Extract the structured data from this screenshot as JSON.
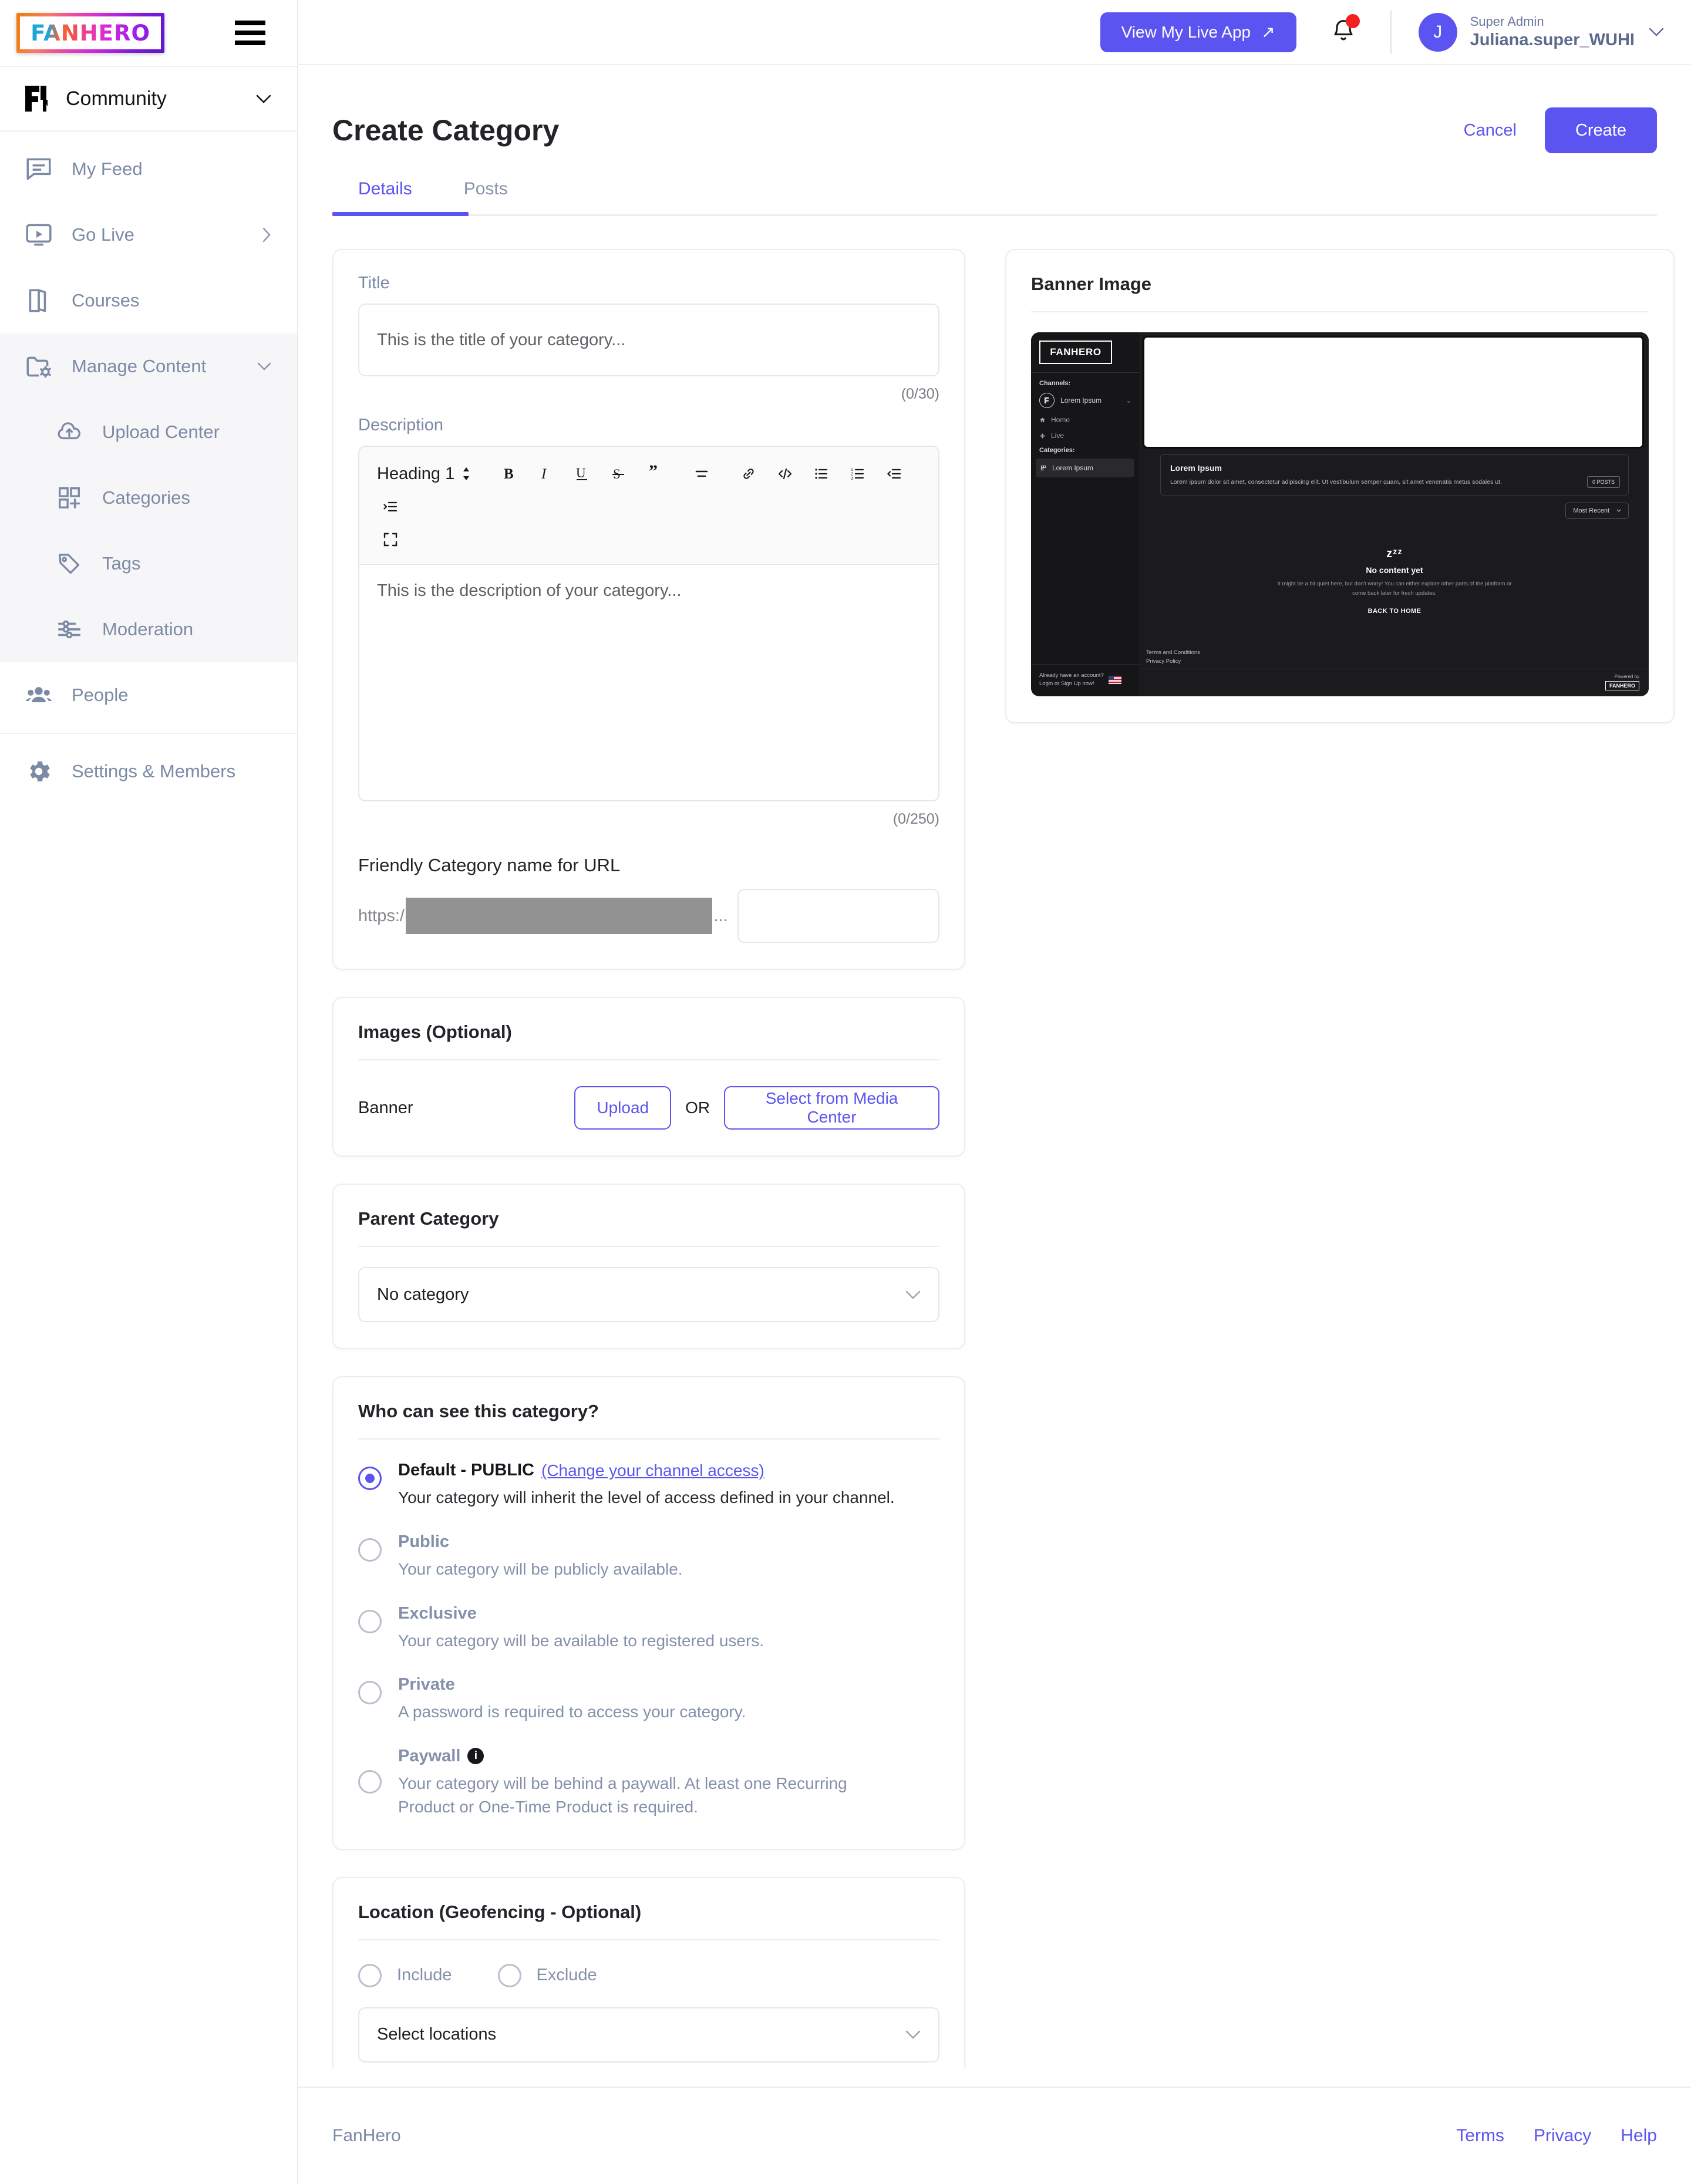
{
  "brand": {
    "logo_text": "FANHERO",
    "footer_name": "FanHero"
  },
  "sidebar": {
    "community": {
      "label": "Community"
    },
    "items": [
      {
        "label": "My Feed",
        "icon": "feed-icon"
      },
      {
        "label": "Go Live",
        "icon": "live-icon"
      },
      {
        "label": "Courses",
        "icon": "courses-icon"
      }
    ],
    "manage": {
      "label": "Manage Content",
      "icon": "folder-gear-icon"
    },
    "manage_children": [
      {
        "label": "Upload Center",
        "icon": "cloud-upload-icon"
      },
      {
        "label": "Categories",
        "icon": "grid-plus-icon"
      },
      {
        "label": "Tags",
        "icon": "tag-icon"
      },
      {
        "label": "Moderation",
        "icon": "sliders-icon"
      }
    ],
    "people": {
      "label": "People",
      "icon": "people-icon"
    },
    "settings": {
      "label": "Settings & Members",
      "icon": "gear-icon"
    }
  },
  "topbar": {
    "live_app_label": "View My Live App",
    "live_app_arrow": "↗",
    "user_role": "Super Admin",
    "user_name": "Juliana.super_WUHI",
    "avatar_initial": "J"
  },
  "page": {
    "title": "Create Category",
    "cancel_label": "Cancel",
    "create_label": "Create",
    "tabs": [
      {
        "label": "Details",
        "active": true
      },
      {
        "label": "Posts",
        "active": false
      }
    ]
  },
  "details": {
    "title_label": "Title",
    "title_placeholder": "This is the title of your category...",
    "title_counter": "(0/30)",
    "description_label": "Description",
    "description_placeholder": "This is the description of your category...",
    "description_counter": "(0/250)",
    "editor_heading": "Heading 1",
    "editor_tools": [
      "bold-icon",
      "italic-icon",
      "underline-icon",
      "strikethrough-icon",
      "quote-icon",
      "align-icon",
      "link-icon",
      "code-icon",
      "bullet-list-icon",
      "numbered-list-icon",
      "outdent-icon",
      "indent-icon",
      "fullscreen-icon"
    ],
    "url_label": "Friendly Category name for URL",
    "url_protocol": "https:/",
    "url_ellipsis": "...",
    "url_slug_value": ""
  },
  "images": {
    "title": "Images (Optional)",
    "banner_label": "Banner",
    "upload_label": "Upload",
    "or_label": "OR",
    "media_center_label": "Select from Media Center"
  },
  "parent_category": {
    "title": "Parent Category",
    "selected": "No category"
  },
  "visibility": {
    "title": "Who can see this category?",
    "options": [
      {
        "label": "Default - PUBLIC",
        "link": "(Change your channel access)",
        "desc": "Your category will inherit the level of access defined in your channel.",
        "selected": true
      },
      {
        "label": "Public",
        "desc": "Your category will be publicly available.",
        "selected": false
      },
      {
        "label": "Exclusive",
        "desc": "Your category will be available to registered users.",
        "selected": false
      },
      {
        "label": "Private",
        "desc": "A password is required to access your category.",
        "selected": false
      },
      {
        "label": "Paywall",
        "info": "i",
        "desc": "Your category will be behind a paywall. At least one Recurring Product or One-Time Product is required.",
        "selected": false
      }
    ]
  },
  "location": {
    "title": "Location (Geofencing - Optional)",
    "include_label": "Include",
    "exclude_label": "Exclude",
    "select_placeholder": "Select locations"
  },
  "banner_preview": {
    "title": "Banner Image",
    "logo": "FANHERO",
    "channels_caption": "Channels:",
    "channel_name": "Lorem Ipsum",
    "channel_chevron": "⌄",
    "nav": [
      {
        "label": "Home"
      },
      {
        "label": "Live"
      }
    ],
    "categories_caption": "Categories:",
    "category_item": "Lorem Ipsum",
    "card_title": "Lorem Ipsum",
    "card_body": "Lorem ipsum dolor sit amet, consectetur adipiscing elit. Ut vestibulum semper quam, sit amet venenatis metus sodales ut.",
    "posts_badge": "0 POSTS",
    "sort_label": "Most Recent",
    "empty_zzz": "zᶻᶻ",
    "empty_title": "No content yet",
    "empty_body": "It might be a bit quiet here, but don't worry! You can either explore other parts of the platform or come back later for fresh updates.",
    "back_home": "BACK TO HOME",
    "login_line1": "Already have an account?",
    "login_line2": "Login or Sign Up now!",
    "terms": "Terms and Conditions",
    "privacy": "Privacy Policy",
    "powered_by": "Powered by",
    "powered_logo": "FANHERO"
  },
  "footer": {
    "brand": "FanHero",
    "links": [
      "Terms",
      "Privacy",
      "Help"
    ]
  },
  "colors": {
    "accent": "#5b54f0",
    "muted": "#8490aa",
    "notification": "#f42020"
  }
}
